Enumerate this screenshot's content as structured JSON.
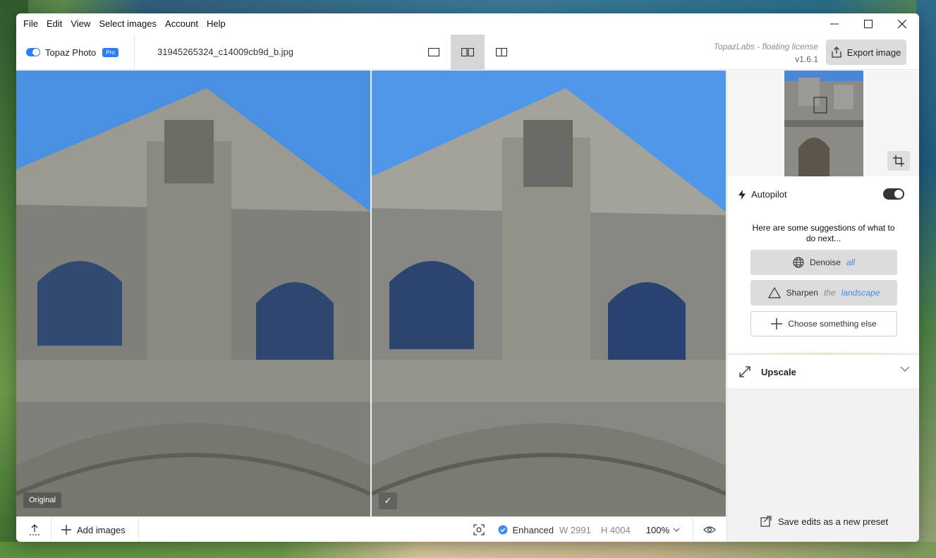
{
  "menu": [
    "File",
    "Edit",
    "View",
    "Select images",
    "Account",
    "Help"
  ],
  "brand": {
    "name": "Topaz Photo",
    "badge": "Pro"
  },
  "file": {
    "name": "31945265324_c14009cb9d_b.jpg"
  },
  "license": {
    "name": "TopazLabs - floating license",
    "version": "v1.6.1"
  },
  "export": {
    "label": "Export image"
  },
  "preview": {
    "left_label": "Original",
    "right_label": "✓"
  },
  "bottombar": {
    "add_images": "Add images",
    "status": "Enhanced",
    "width": "W 2991",
    "height": "H 4004",
    "zoom": "100%"
  },
  "panel": {
    "autopilot": "Autopilot",
    "suggestions_text": "Here are some suggestions of what to do next...",
    "denoise": {
      "label": "Denoise",
      "target": "all"
    },
    "sharpen": {
      "label": "Sharpen",
      "article": "the",
      "target": "landscape"
    },
    "choose": "Choose something else",
    "upscale": "Upscale",
    "preset": "Save edits as a new preset"
  },
  "colors": {
    "accent": "#2d7df6",
    "link": "#3f8cf0",
    "sky": "#4f97e8",
    "stone": "#8f9088"
  }
}
